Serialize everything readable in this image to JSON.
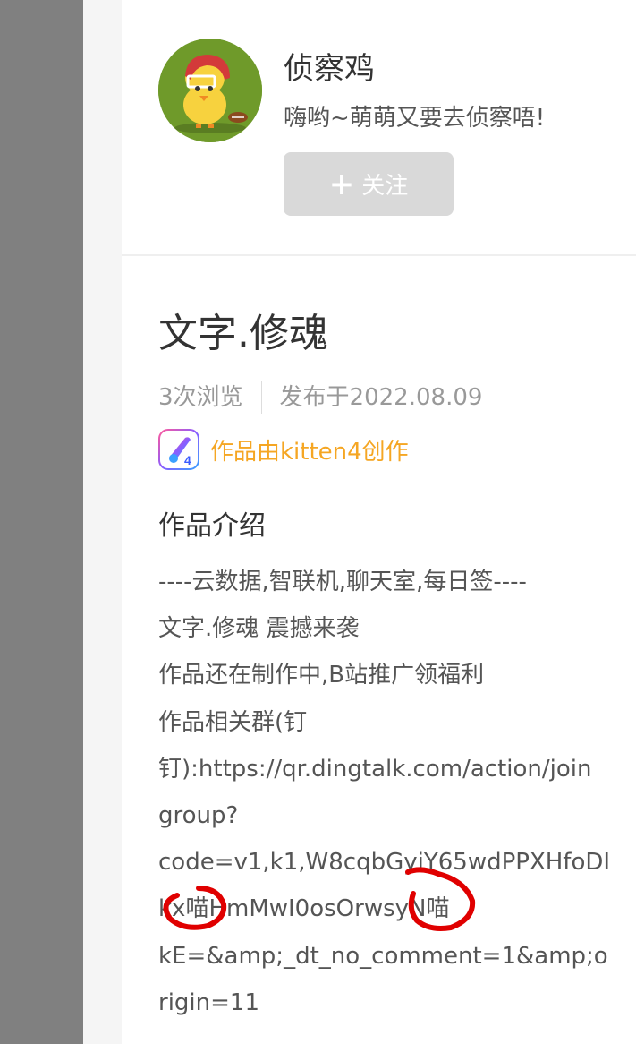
{
  "author": {
    "name": "侦察鸡",
    "bio": "嗨哟~萌萌又要去侦察唔!",
    "follow_label": "关注",
    "follow_icon": "plus-icon",
    "avatar_icon": "chick-football-avatar"
  },
  "work": {
    "title": "文字.修魂",
    "views": "3次浏览",
    "published": "发布于2022.08.09",
    "creator_text": "作品由kitten4创作",
    "creator_icon": "kitten4-app-icon",
    "creator_color": "#f5a623"
  },
  "intro": {
    "heading": "作品介绍",
    "lines": [
      "----云数据,智联机,聊天室,每日签----",
      "文字.修魂 震撼来袭",
      "作品还在制作中,B站推广领福利",
      "作品相关群(钉",
      "钉):https://qr.dingtalk.com/action/join",
      "group?",
      "code=v1,k1,W8cqbGyiY65wdPPXHfoDI",
      "kx喵HmMwI0osOrwsyN喵",
      "kE=&amp;_dt_no_comment=1&amp;o",
      "rigin=11"
    ]
  },
  "colors": {
    "accent": "#f5a623",
    "annotation_red": "#e00000",
    "follow_button_bg": "#d9d9d9"
  }
}
